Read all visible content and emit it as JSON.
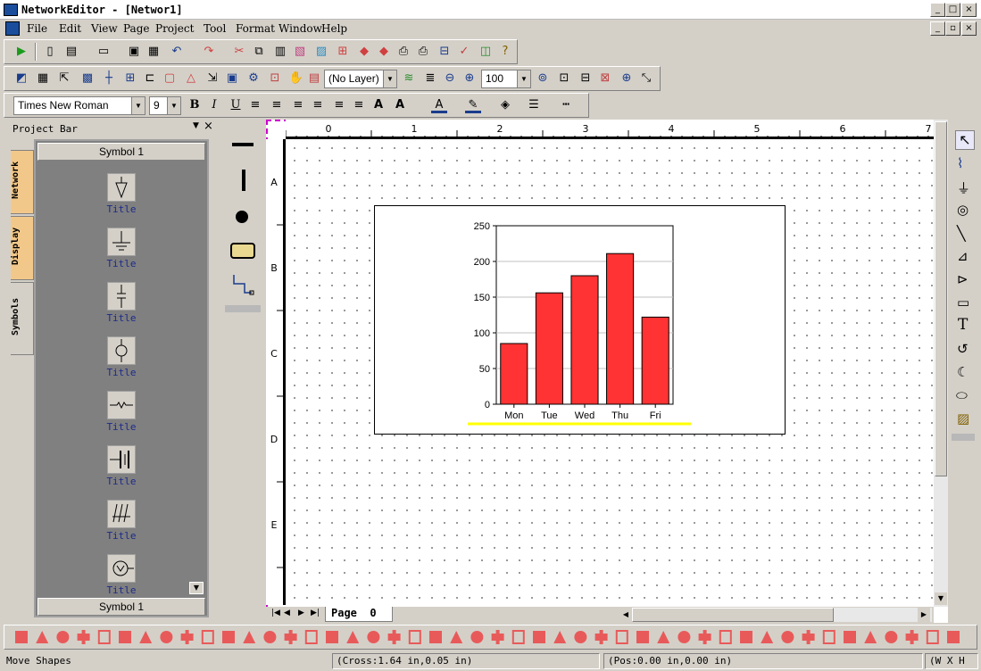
{
  "window": {
    "title": "NetworkEditor - [Networ1]"
  },
  "menu": [
    "File",
    "Edit",
    "View",
    "Page",
    "Project",
    "Tool",
    "Format",
    "Window",
    "Help"
  ],
  "toolbar": {
    "layer_value": "(No Layer)",
    "zoom_value": "100"
  },
  "format_toolbar": {
    "font_family": "Times New Roman",
    "font_size": "9"
  },
  "project_bar": {
    "title": "Project Bar",
    "tabs": [
      "Network",
      "Display",
      "Symbols"
    ],
    "panel_header": "Symbol 1",
    "panel_footer": "Symbol 1",
    "symbols": [
      {
        "label": "Title",
        "icon": "triangle-down-icon"
      },
      {
        "label": "Title",
        "icon": "ground-icon"
      },
      {
        "label": "Title",
        "icon": "capacitor-icon"
      },
      {
        "label": "Title",
        "icon": "generator-icon"
      },
      {
        "label": "Title",
        "icon": "resistor-icon"
      },
      {
        "label": "Title",
        "icon": "battery-icon"
      },
      {
        "label": "Title",
        "icon": "earth-hatch-icon"
      },
      {
        "label": "Title",
        "icon": "motor-icon"
      }
    ]
  },
  "rulers": {
    "top": [
      "0",
      "1",
      "2",
      "3",
      "4",
      "5",
      "6",
      "7"
    ],
    "left": [
      "A",
      "B",
      "C",
      "D",
      "E"
    ]
  },
  "page_tab": {
    "label": "Page",
    "number": "0"
  },
  "colors": {
    "bar": "#ff3333",
    "highlight": "#ffff00",
    "page_border": "#cc00cc"
  },
  "chart_data": {
    "type": "bar",
    "categories": [
      "Mon",
      "Tue",
      "Wed",
      "Thu",
      "Fri"
    ],
    "values": [
      85,
      156,
      180,
      211,
      122
    ],
    "ylim": [
      0,
      250
    ],
    "yticks": [
      0,
      50,
      100,
      150,
      200,
      250
    ],
    "grid": true
  },
  "status": {
    "message": "Move Shapes",
    "cross": "(Cross:1.64 in,0.05 in)",
    "pos": "(Pos:0.00 in,0.00 in)",
    "size": "(W X H"
  }
}
